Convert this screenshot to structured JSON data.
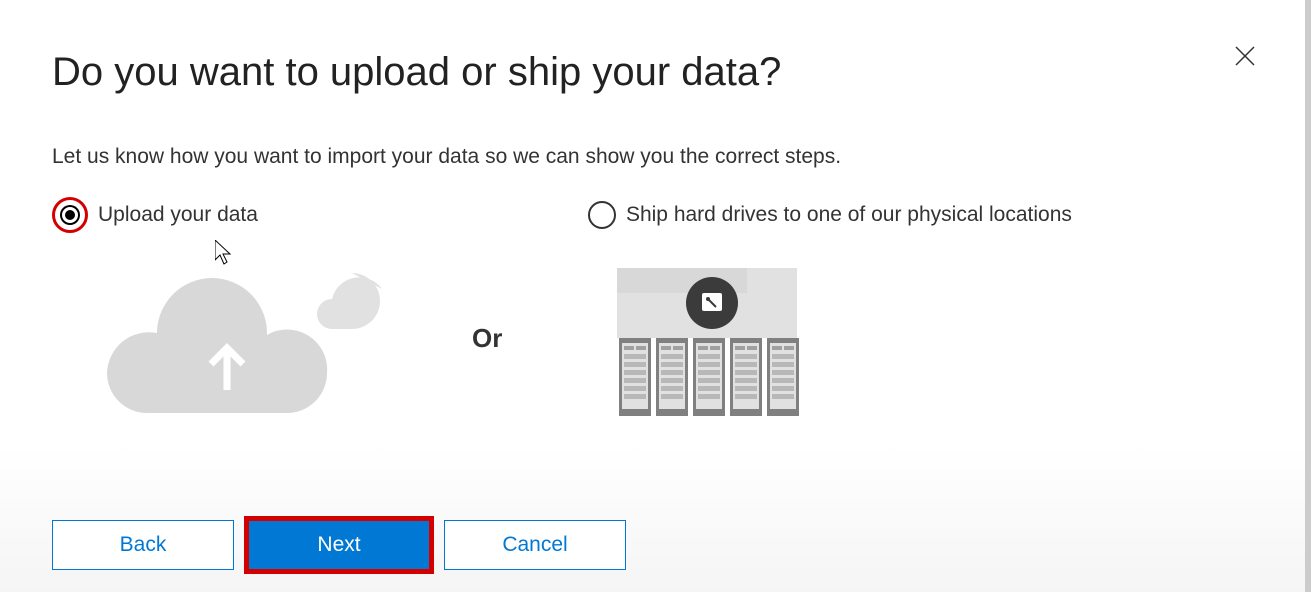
{
  "title": "Do you want to upload or ship your data?",
  "subtitle": "Let us know how you want to import your data so we can show you the correct steps.",
  "options": {
    "upload": {
      "label": "Upload your data",
      "selected": true
    },
    "ship": {
      "label": "Ship hard drives to one of our physical locations",
      "selected": false
    }
  },
  "separator": "Or",
  "buttons": {
    "back": "Back",
    "next": "Next",
    "cancel": "Cancel"
  }
}
